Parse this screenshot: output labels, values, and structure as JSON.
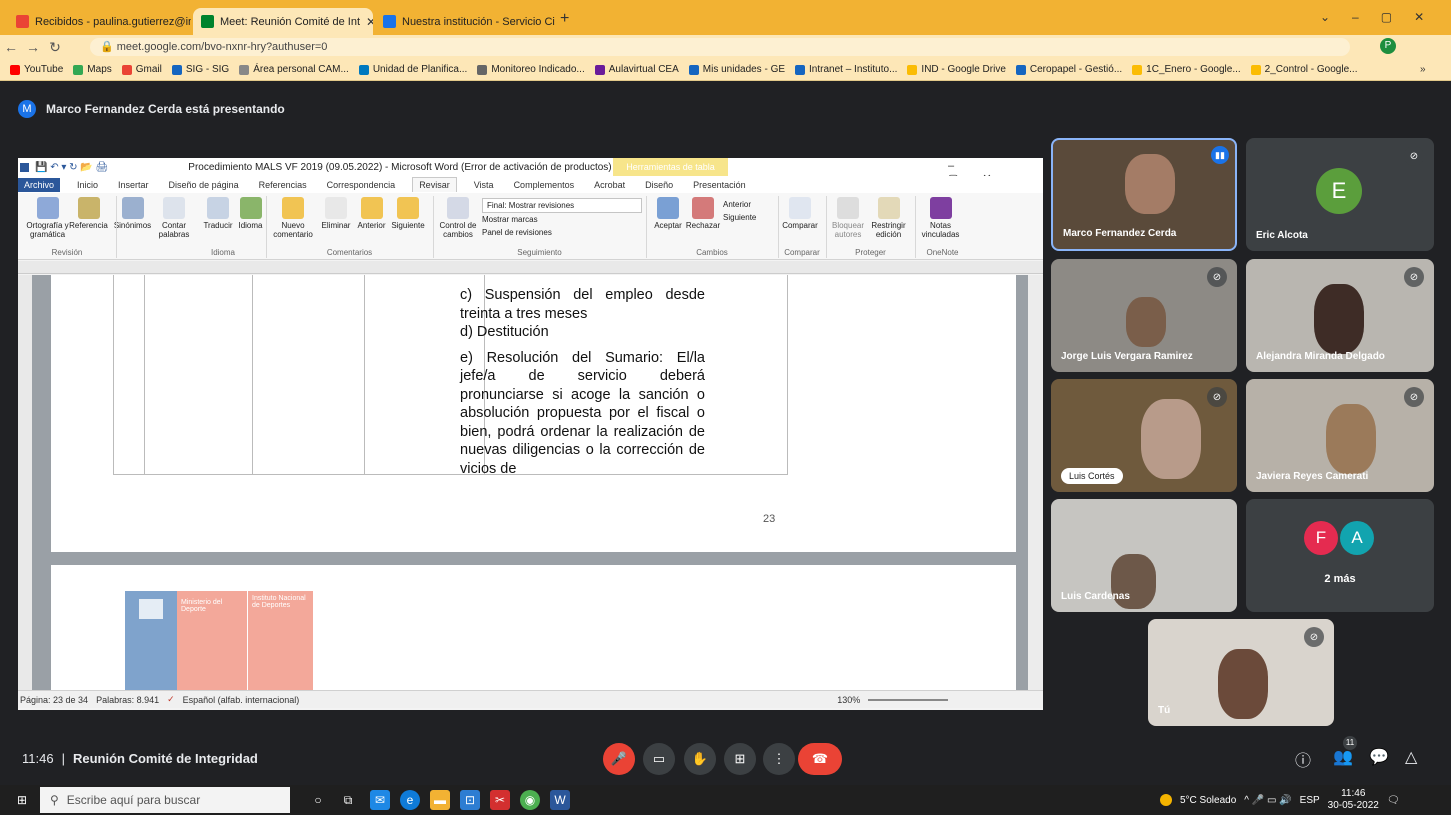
{
  "browser": {
    "tabs": [
      {
        "label": "Recibidos - paulina.gutierrez@in",
        "color": "#ea4335"
      },
      {
        "label": "Meet: Reunión Comité de Int",
        "color": "#00832d"
      },
      {
        "label": "Nuestra institución - Servicio Civ",
        "color": "#1a73e8"
      }
    ],
    "new_tab": "+",
    "url": "meet.google.com/bvo-nxnr-hry?authuser=0",
    "profile_initial": "P",
    "bookmarks": [
      "YouTube",
      "Maps",
      "Gmail",
      "SIG - SIG",
      "Área personal CAM...",
      "Unidad de Planifica...",
      "Monitoreo Indicado...",
      "Aulavirtual CEA",
      "Mis unidades - GE",
      "Intranet – Instituto...",
      "IND - Google Drive",
      "Ceropapel - Gestió...",
      "1C_Enero - Google...",
      "2_Control - Google..."
    ],
    "bookmarks_more": "»"
  },
  "presenting": {
    "initial": "M",
    "text": "Marco Fernandez Cerda está presentando"
  },
  "word": {
    "title": "Procedimiento MALS VF 2019 (09.05.2022)  -  Microsoft Word (Error de activación de productos)",
    "context_tab": "Herramientas de tabla",
    "tabs": [
      "Archivo",
      "Inicio",
      "Insertar",
      "Diseño de página",
      "Referencias",
      "Correspondencia",
      "Revisar",
      "Vista",
      "Complementos",
      "Acrobat",
      "Diseño",
      "Presentación"
    ],
    "ribbon_buttons": [
      "Ortografía y gramática",
      "Referencia",
      "Sinónimos",
      "Contar palabras",
      "Traducir",
      "Idioma",
      "Nuevo comentario",
      "Eliminar",
      "Anterior",
      "Siguiente",
      "Control de cambios",
      "Aceptar",
      "Rechazar",
      "Comparar",
      "Bloquear autores",
      "Restringir edición",
      "Notas vinculadas"
    ],
    "tracking": {
      "display": "Final: Mostrar revisiones",
      "markup": "Mostrar marcas",
      "pane": "Panel de revisiones"
    },
    "changes_nav": {
      "prev": "Anterior",
      "next": "Siguiente"
    },
    "groups": [
      "Revisión",
      "Idioma",
      "Comentarios",
      "Seguimiento",
      "Cambios",
      "Comparar",
      "Proteger",
      "OneNote"
    ],
    "doc_lines": [
      "c)  Suspensión del empleo desde treinta a tres meses",
      "d)  Destitución",
      "e) Resolución del Sumario: El/la jefe/a de servicio deberá pronunciarse si acoge la sanción o absolución propuesta por el fiscal o bien, podrá ordenar la realización de nuevas diligencias o la corrección de vicios de"
    ],
    "page_number": "23",
    "logo_left": "Ministerio del Deporte",
    "logo_right": "Instituto Nacional de Deportes",
    "status": {
      "page": "Página: 23 de 34",
      "words": "Palabras: 8.941",
      "lang": "Español (alfab. internacional)",
      "zoom": "130%"
    }
  },
  "participants": [
    {
      "name": "Marco Fernandez Cerda",
      "speaking": true
    },
    {
      "name": "Eric Alcota",
      "initial": "E",
      "color": "#5b9e3c"
    },
    {
      "name": "Jorge Luis Vergara Ramirez"
    },
    {
      "name": "Alejandra Miranda Delgado"
    },
    {
      "name": "Luis Cortés"
    },
    {
      "name": "Javiera Reyes Camerati"
    },
    {
      "name": "Luis Cardenas"
    },
    {
      "name": "2 más",
      "initials": [
        "F",
        "A"
      ],
      "colors": [
        "#e52b50",
        "#12a4af"
      ]
    },
    {
      "name": "Tú"
    }
  ],
  "meeting": {
    "time": "11:46",
    "separator": "|",
    "title": "Reunión Comité de Integridad",
    "people_count": "11"
  },
  "taskbar": {
    "search": "Escribe aquí para buscar",
    "weather": "5°C  Soleado",
    "lang": "ESP",
    "time": "11:46",
    "date": "30-05-2022"
  }
}
